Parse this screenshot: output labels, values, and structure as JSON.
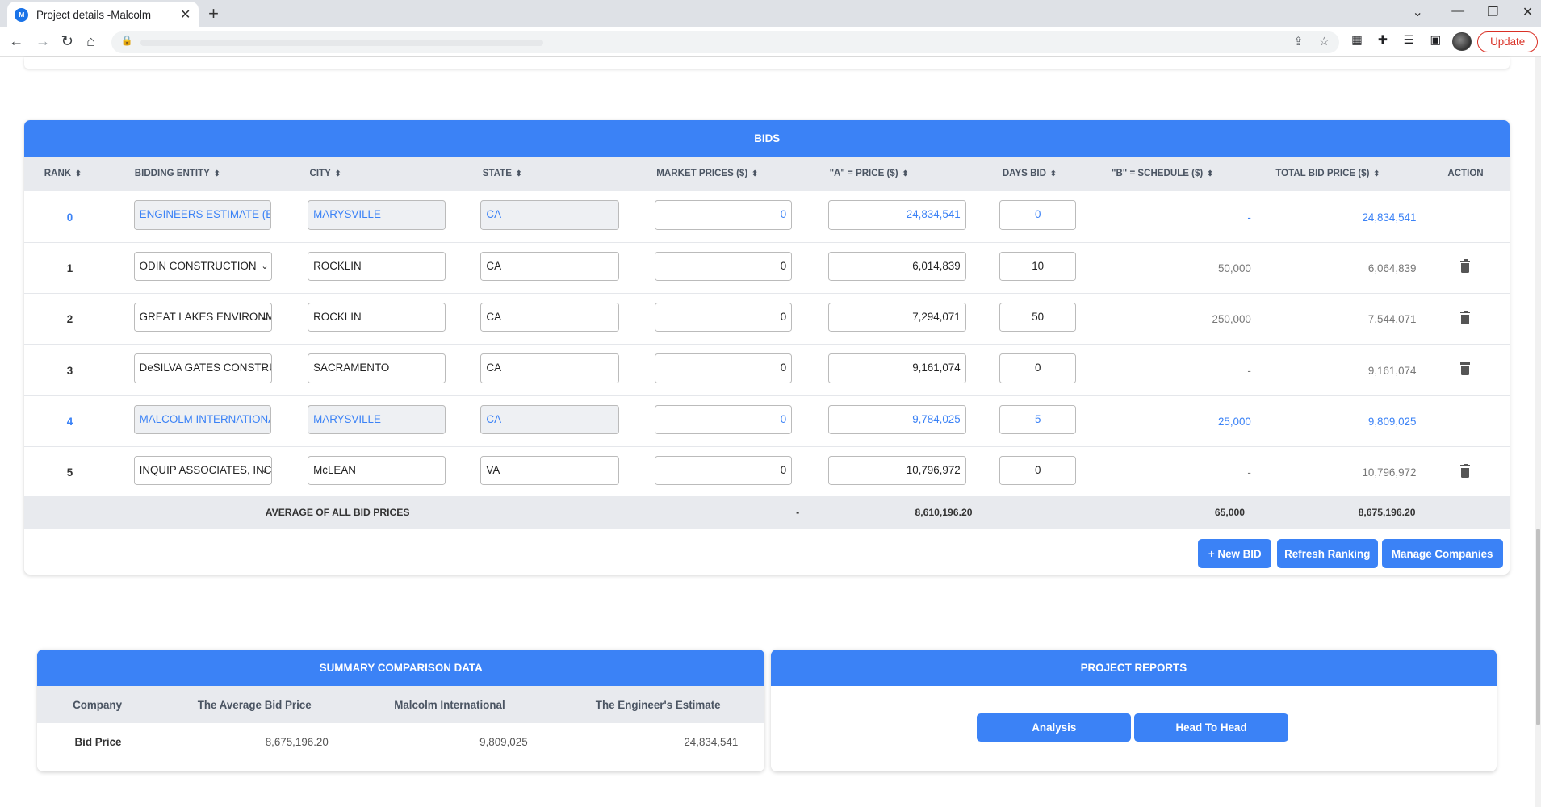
{
  "browser": {
    "tab_title": "Project details -Malcolm",
    "favicon_text": "M",
    "new_tab": "+",
    "update_label": "Update"
  },
  "bids": {
    "title": "BIDS",
    "columns": {
      "rank": "RANK",
      "entity": "BIDDING ENTITY",
      "city": "CITY",
      "state": "STATE",
      "market": "MARKET PRICES ($)",
      "a_price": "\"A\" = PRICE ($)",
      "days": "DAYS BID",
      "b_schedule": "\"B\" = SCHEDULE ($)",
      "total": "TOTAL BID PRICE ($)",
      "action": "ACTION"
    },
    "rows": [
      {
        "rank": "0",
        "entity": "ENGINEERS ESTIMATE (EE)",
        "city": "MARYSVILLE",
        "state": "CA",
        "market": "0",
        "a_price": "24,834,541",
        "days": "0",
        "b_schedule": "-",
        "total": "24,834,541"
      },
      {
        "rank": "1",
        "entity": "ODIN CONSTRUCTION",
        "city": "ROCKLIN",
        "state": "CA",
        "market": "0",
        "a_price": "6,014,839",
        "days": "10",
        "b_schedule": "50,000",
        "total": "6,064,839"
      },
      {
        "rank": "2",
        "entity": "GREAT LAKES ENVIRONMENTAL",
        "city": "ROCKLIN",
        "state": "CA",
        "market": "0",
        "a_price": "7,294,071",
        "days": "50",
        "b_schedule": "250,000",
        "total": "7,544,071"
      },
      {
        "rank": "3",
        "entity": "DeSILVA GATES CONSTRUCTION",
        "city": "SACRAMENTO",
        "state": "CA",
        "market": "0",
        "a_price": "9,161,074",
        "days": "0",
        "b_schedule": "-",
        "total": "9,161,074"
      },
      {
        "rank": "4",
        "entity": "MALCOLM INTERNATIONAL",
        "city": "MARYSVILLE",
        "state": "CA",
        "market": "0",
        "a_price": "9,784,025",
        "days": "5",
        "b_schedule": "25,000",
        "total": "9,809,025"
      },
      {
        "rank": "5",
        "entity": "INQUIP ASSOCIATES, INC",
        "city": "McLEAN",
        "state": "VA",
        "market": "0",
        "a_price": "10,796,972",
        "days": "0",
        "b_schedule": "-",
        "total": "10,796,972"
      }
    ],
    "average": {
      "label": "AVERAGE OF ALL BID PRICES",
      "market": "-",
      "a_price": "8,610,196.20",
      "b_schedule": "65,000",
      "total": "8,675,196.20"
    },
    "buttons": {
      "new_bid": "+ New BID",
      "refresh": "Refresh Ranking",
      "manage": "Manage Companies"
    }
  },
  "summary": {
    "title": "SUMMARY COMPARISON DATA",
    "headers": {
      "company": "Company",
      "avg": "The Average Bid Price",
      "malcolm": "Malcolm International",
      "engineer": "The Engineer's Estimate"
    },
    "row": {
      "label": "Bid Price",
      "avg": "8,675,196.20",
      "malcolm": "9,809,025",
      "engineer": "24,834,541"
    }
  },
  "reports": {
    "title": "PROJECT REPORTS",
    "analysis": "Analysis",
    "head_to_head": "Head To Head"
  },
  "colors": {
    "accent": "#3b82f6",
    "header_bg": "#e8eaee"
  }
}
